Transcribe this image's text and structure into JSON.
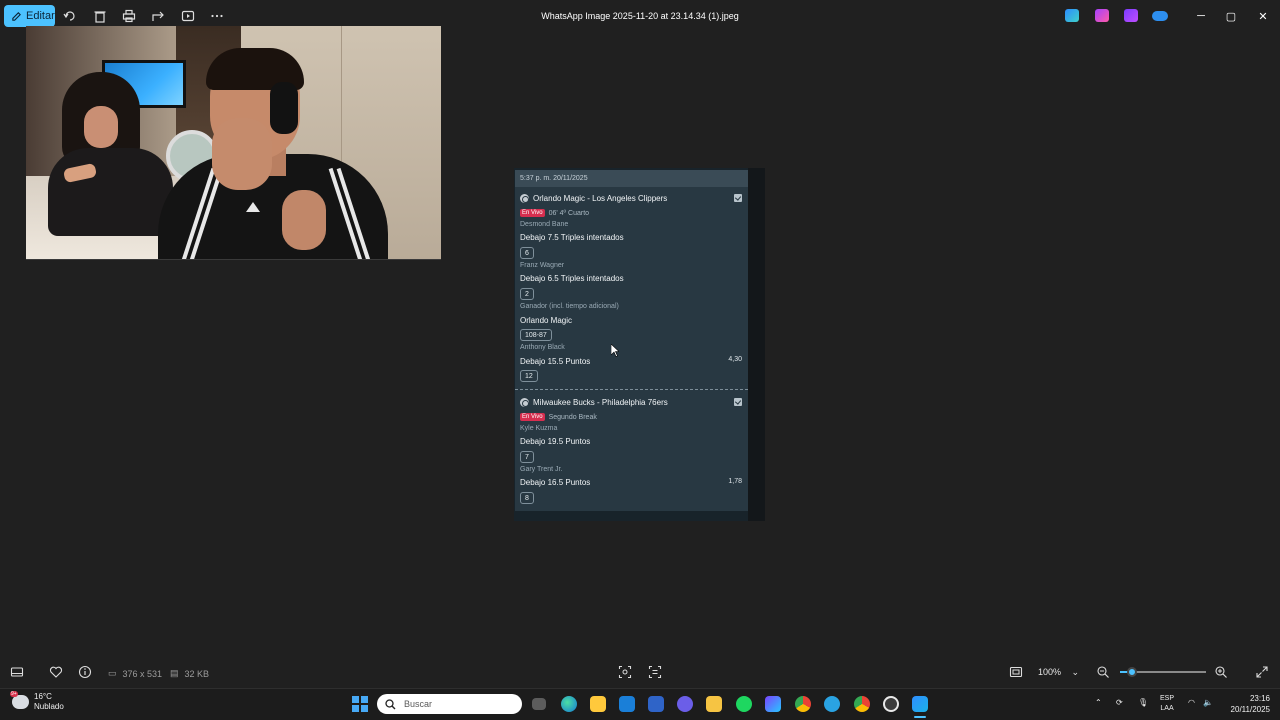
{
  "toolbar": {
    "edit_label": "Editar",
    "title": "WhatsApp Image 2025-11-20 at 23.14.34 (1).jpeg"
  },
  "icons": [
    "edit-icon",
    "rotate-icon",
    "delete-icon",
    "print-icon",
    "share-icon",
    "slideshow-icon",
    "more-icon",
    "designer-icon",
    "clipchamp-icon",
    "video-editor-icon",
    "onedrive-icon"
  ],
  "ticket": {
    "timestamp": "5:37 p. m. 20/11/2025",
    "match1": {
      "title": "Orlando Magic - Los Angeles Clippers",
      "live_badge": "En Vivo",
      "status": "06' 4º Cuarto",
      "bets": [
        {
          "player": "Desmond Bane",
          "market": "Debajo 7.5 Triples intentados",
          "result": "6"
        },
        {
          "player": "Franz Wagner",
          "market": "Debajo 6.5 Triples intentados",
          "result": "2"
        },
        {
          "player": "Ganador (incl. tiempo adicional)",
          "market": "Orlando Magic",
          "result": "108-87"
        },
        {
          "player": "Anthony Black",
          "market": "Debajo 15.5 Puntos",
          "result": "12",
          "odds": "4,30"
        }
      ]
    },
    "match2": {
      "title": "Milwaukee Bucks - Philadelphia 76ers",
      "live_badge": "En Vivo",
      "status": "Segundo Break",
      "bets": [
        {
          "player": "Kyle Kuzma",
          "market": "Debajo 19.5 Puntos",
          "result": "7"
        },
        {
          "player": "Gary Trent Jr.",
          "market": "Debajo 16.5 Puntos",
          "result": "8",
          "odds": "1,78"
        }
      ]
    }
  },
  "bottom": {
    "dimensions": "376 x 531",
    "size": "32 KB",
    "zoom": "100%",
    "zoom_level": 0.14
  },
  "taskbar": {
    "temperature": "16°C",
    "weather": "Nublado",
    "weather_badge": "9+",
    "search_placeholder": "Buscar",
    "lang1": "ESP",
    "lang2": "LAA",
    "time": "23:16",
    "date": "20/11/2025"
  },
  "colors": {
    "accent": "#4cc2ff",
    "live": "#d62e4f",
    "ticket_bg": "#283842"
  }
}
